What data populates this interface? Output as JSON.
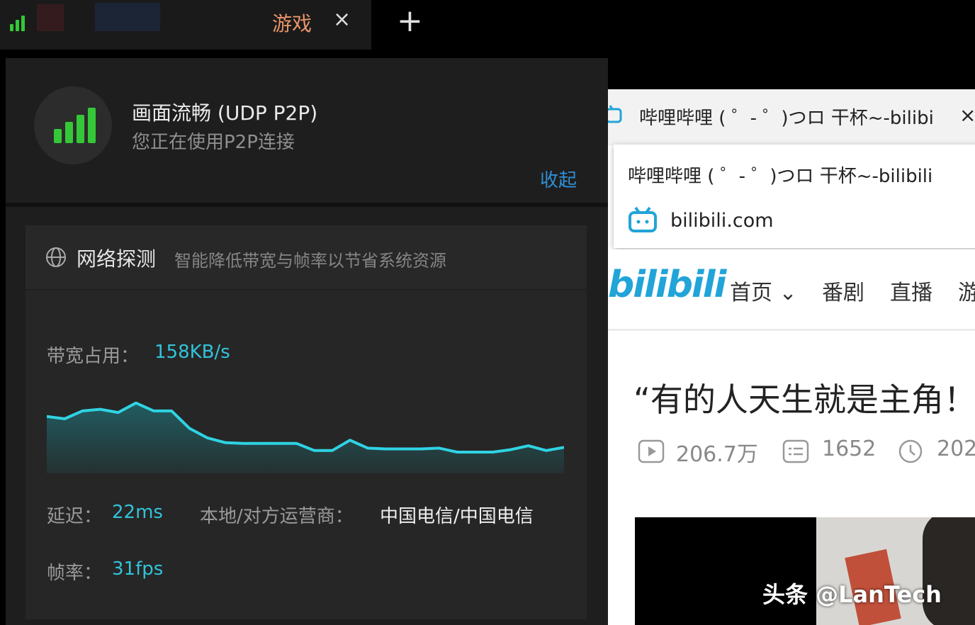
{
  "tabbar": {
    "active_tab_title": "游戏",
    "close_glyph": "×",
    "new_tab_glyph": "+"
  },
  "status": {
    "title": "画面流畅 (UDP P2P)",
    "subtitle": "您正在使用P2P连接",
    "collapse_label": "收起",
    "signal_color": "#34c838"
  },
  "network": {
    "title": "网络探测",
    "description": "智能降低带宽与帧率以节省系统资源",
    "bandwidth_label": "带宽占用：",
    "bandwidth_value": "158KB/s",
    "latency_label": "延迟：",
    "latency_value": "22ms",
    "isp_label": "本地/对方运营商：",
    "isp_value": "中国电信/中国电信",
    "fps_label": "帧率：",
    "fps_value": "31fps",
    "accent_color": "#32c3d9",
    "bandwidth_series": [
      0.45,
      0.42,
      0.52,
      0.54,
      0.5,
      0.62,
      0.52,
      0.52,
      0.3,
      0.18,
      0.12,
      0.11,
      0.11,
      0.11,
      0.11,
      0.02,
      0.02,
      0.15,
      0.05,
      0.04,
      0.04,
      0.04,
      0.05,
      0.0,
      0.0,
      0.0,
      0.03,
      0.08,
      0.02,
      0.06
    ]
  },
  "browser": {
    "tab_title": "哔哩哔哩 ( ゜- ゜)つロ 干杯~-bilibi",
    "tab_close": "×",
    "tooltip_title": "哔哩哔哩 ( ゜- ゜)つロ 干杯~-bilibili",
    "tooltip_domain": "bilibili.com",
    "logo_text": "bilibili",
    "nav": [
      "首页",
      "番剧",
      "直播",
      "游"
    ],
    "nav_first_chevron": "⌄",
    "video_title": "“有的人天生就是主角！",
    "views": "206.7万",
    "danmaku": "1652",
    "date": "202",
    "brand_color": "#21a4d8"
  },
  "watermark": "头条 @LanTech"
}
